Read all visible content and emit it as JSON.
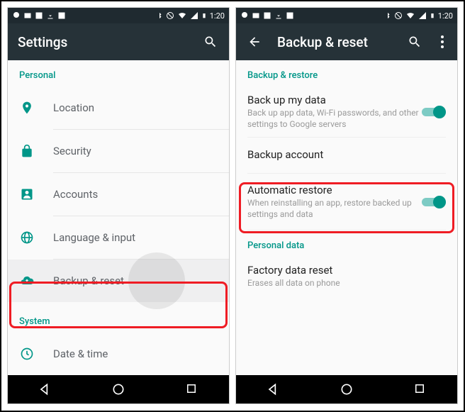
{
  "status": {
    "time": "1:20"
  },
  "left": {
    "title": "Settings",
    "section1": "Personal",
    "items": [
      {
        "label": "Location"
      },
      {
        "label": "Security"
      },
      {
        "label": "Accounts"
      },
      {
        "label": "Language & input"
      },
      {
        "label": "Backup & reset"
      }
    ],
    "section2": "System",
    "items2": [
      {
        "label": "Date & time"
      }
    ]
  },
  "right": {
    "title": "Backup & reset",
    "section1": "Backup & restore",
    "backup_my_data": {
      "title": "Back up my data",
      "desc": "Back up app data, Wi-Fi passwords, and other settings to Google servers"
    },
    "backup_account": {
      "title": "Backup account"
    },
    "automatic_restore": {
      "title": "Automatic restore",
      "desc": "When reinstalling an app, restore backed up settings and data"
    },
    "section2": "Personal data",
    "factory_reset": {
      "title": "Factory data reset",
      "desc": "Erases all data on phone"
    }
  }
}
